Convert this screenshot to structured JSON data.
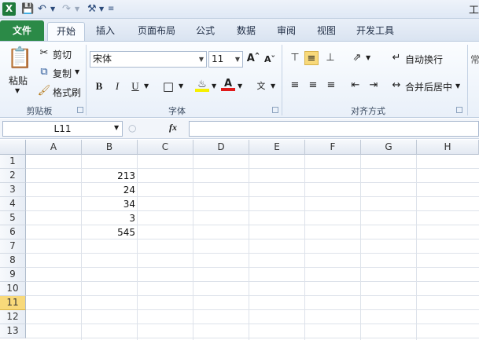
{
  "qat": {
    "logo": "X",
    "title_fragment": "工"
  },
  "tabs": [
    "文件",
    "开始",
    "插入",
    "页面布局",
    "公式",
    "数据",
    "审阅",
    "视图",
    "开发工具"
  ],
  "clipboard": {
    "paste": "粘贴",
    "cut": "剪切",
    "copy": "复制",
    "format_painter": "格式刷",
    "group": "剪贴板"
  },
  "font": {
    "name": "宋体",
    "size": "11",
    "group": "字体",
    "bold": "B",
    "italic": "I",
    "underline": "U"
  },
  "alignment": {
    "wrap": "自动换行",
    "merge": "合并后居中",
    "group": "对齐方式"
  },
  "formula_bar": {
    "name_box": "L11",
    "fx": "fx",
    "value": ""
  },
  "sheet": {
    "columns": [
      "A",
      "B",
      "C",
      "D",
      "E",
      "F",
      "G",
      "H"
    ],
    "rows": [
      "1",
      "2",
      "3",
      "4",
      "5",
      "6",
      "7",
      "8",
      "9",
      "10",
      "11",
      "12",
      "13"
    ],
    "selected_row": "11",
    "b_values": {
      "2": "213",
      "3": "24",
      "4": "34",
      "5": "3",
      "6": "545"
    }
  }
}
